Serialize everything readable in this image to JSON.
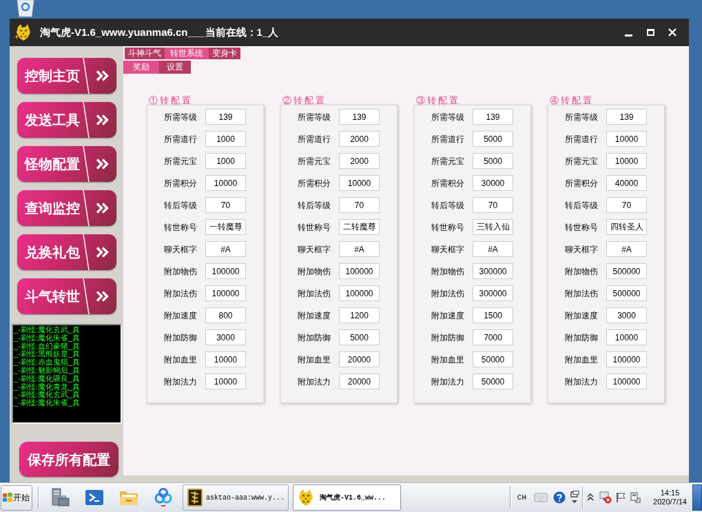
{
  "window": {
    "title": "淘气虎-V1.6_www.yuanma6.cn___当前在线：1_人"
  },
  "sidebar": {
    "items": [
      {
        "label": "控制主页"
      },
      {
        "label": "发送工具"
      },
      {
        "label": "怪物配置"
      },
      {
        "label": "查询监控"
      },
      {
        "label": "兑换礼包"
      },
      {
        "label": "斗气转世"
      }
    ],
    "log": [
      "_-刷怪:魔化玄武_真",
      "_-刷怪:魔化朱雀_真",
      "_-刷怪:血幻豪猪_真",
      "_-刷怪:黑熊妖皇_真",
      "_-刷怪:赤血鬼猖_真",
      "_-刷怪:魅影蝎后_真",
      "_-刷怪:魔化疆良_真",
      "_-刷怪:魔化青龙_真",
      "_-刷怪:魔化玄武_真",
      "_-刷怪:魔化朱雀_真"
    ],
    "save_button": {
      "label": "保存所有配置"
    }
  },
  "tabs": [
    {
      "label": "斗神斗气",
      "selected": false
    },
    {
      "label": "转世系统",
      "selected": true
    },
    {
      "label": "变身卡",
      "selected": false
    }
  ],
  "subtabs": [
    {
      "label": "奖励",
      "selected": true
    },
    {
      "label": "设置",
      "selected": false
    }
  ],
  "groups": [
    {
      "title": "①转配置",
      "fields": [
        {
          "label": "所需等级",
          "value": "139"
        },
        {
          "label": "所需道行",
          "value": "1000"
        },
        {
          "label": "所需元宝",
          "value": "1000"
        },
        {
          "label": "所需积分",
          "value": "10000"
        },
        {
          "label": "转后等级",
          "value": "70"
        },
        {
          "label": "转世称号",
          "value": "一转魔尊"
        },
        {
          "label": "聊天框字",
          "value": "#A"
        },
        {
          "label": "附加物伤",
          "value": "100000"
        },
        {
          "label": "附加法伤",
          "value": "100000"
        },
        {
          "label": "附加速度",
          "value": "800"
        },
        {
          "label": "附加防御",
          "value": "3000"
        },
        {
          "label": "附加血里",
          "value": "10000"
        },
        {
          "label": "附加法力",
          "value": "10000"
        }
      ]
    },
    {
      "title": "②转配置",
      "fields": [
        {
          "label": "所需等级",
          "value": "139"
        },
        {
          "label": "所需道行",
          "value": "2000"
        },
        {
          "label": "所需元宝",
          "value": "2000"
        },
        {
          "label": "所需积分",
          "value": "10000"
        },
        {
          "label": "转后等级",
          "value": "70"
        },
        {
          "label": "转世称号",
          "value": "二转魔尊"
        },
        {
          "label": "聊天框字",
          "value": "#A"
        },
        {
          "label": "附加物伤",
          "value": "100000"
        },
        {
          "label": "附加法伤",
          "value": "100000"
        },
        {
          "label": "附加速度",
          "value": "1200"
        },
        {
          "label": "附加防御",
          "value": "5000"
        },
        {
          "label": "附加血里",
          "value": "20000"
        },
        {
          "label": "附加法力",
          "value": "20000"
        }
      ]
    },
    {
      "title": "③转配置",
      "fields": [
        {
          "label": "所需等级",
          "value": "139"
        },
        {
          "label": "所需道行",
          "value": "5000"
        },
        {
          "label": "所需元宝",
          "value": "5000"
        },
        {
          "label": "所需积分",
          "value": "30000"
        },
        {
          "label": "转后等级",
          "value": "70"
        },
        {
          "label": "转世称号",
          "value": "三转入仙"
        },
        {
          "label": "聊天框字",
          "value": "#A"
        },
        {
          "label": "附加物伤",
          "value": "300000"
        },
        {
          "label": "附加法伤",
          "value": "300000"
        },
        {
          "label": "附加速度",
          "value": "1500"
        },
        {
          "label": "附加防御",
          "value": "7000"
        },
        {
          "label": "附加血里",
          "value": "50000"
        },
        {
          "label": "附加法力",
          "value": "50000"
        }
      ]
    },
    {
      "title": "④转配置",
      "fields": [
        {
          "label": "所需等级",
          "value": "139"
        },
        {
          "label": "所需道行",
          "value": "10000"
        },
        {
          "label": "所需元宝",
          "value": "10000"
        },
        {
          "label": "所需积分",
          "value": "40000"
        },
        {
          "label": "转后等级",
          "value": "70"
        },
        {
          "label": "转世称号",
          "value": "四转圣人"
        },
        {
          "label": "聊天框字",
          "value": "#A"
        },
        {
          "label": "附加物伤",
          "value": "500000"
        },
        {
          "label": "附加法伤",
          "value": "500000"
        },
        {
          "label": "附加速度",
          "value": "3000"
        },
        {
          "label": "附加防御",
          "value": "10000"
        },
        {
          "label": "附加血里",
          "value": "100000"
        },
        {
          "label": "附加法力",
          "value": "100000"
        }
      ]
    }
  ],
  "taskbar": {
    "start": {
      "label": "开始"
    },
    "tasks": [
      {
        "label": "asktao-aaa:www.y...",
        "selected": false
      },
      {
        "label": "淘气虎-V1.6_ww...",
        "selected": true
      }
    ],
    "language": "CH",
    "time": "14:15",
    "date": "2020/7/14"
  }
}
